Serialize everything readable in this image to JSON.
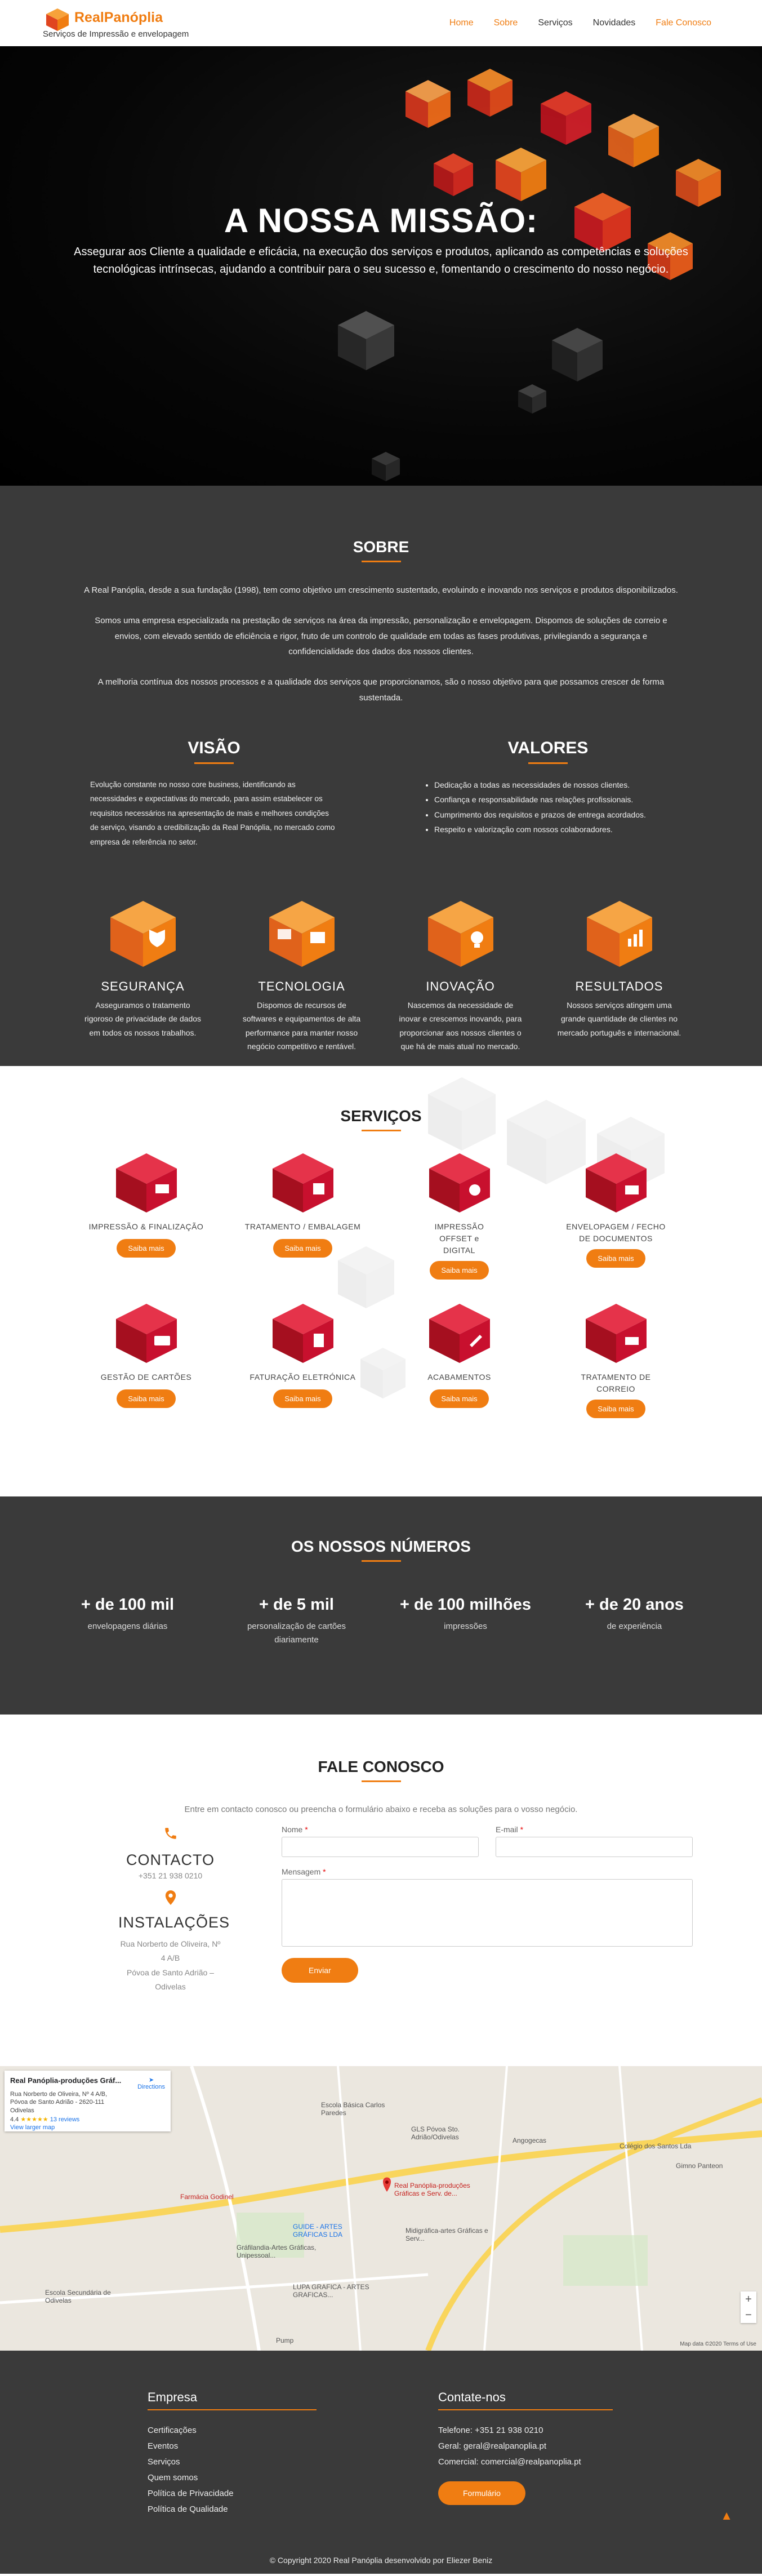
{
  "header": {
    "brand": "RealPanóplia",
    "tagline": "Serviços de Impressão e envelopagem",
    "nav": [
      "Home",
      "Sobre",
      "Serviços",
      "Novidades",
      "Fale Conosco"
    ]
  },
  "hero": {
    "title": "A NOSSA MISSÃO:",
    "text": "Assegurar aos Cliente a qualidade e eficácia, na execução dos serviços e produtos, aplicando as competências e soluções tecnológicas intrínsecas, ajudando a contribuir para o seu sucesso e, fomentando o crescimento do nosso negócio."
  },
  "sobre": {
    "title": "SOBRE",
    "p1": "A Real Panóplia, desde a sua fundação (1998), tem como objetivo um crescimento sustentado, evoluindo e inovando nos serviços e produtos disponibilizados.",
    "p2": "Somos uma empresa especializada na prestação de serviços na área da impressão, personalização e envelopagem. Dispomos de soluções de correio e envios, com elevado sentido de eficiência e rigor, fruto de um controlo de qualidade em todas as fases produtivas, privilegiando a segurança e confidencialidade dos dados dos nossos clientes.",
    "p3": "A melhoria contínua dos nossos processos e a qualidade dos serviços que proporcionamos, são o nosso objetivo para que possamos crescer de forma sustentada.",
    "visao_title": "VISÃO",
    "visao_text": "Evolução constante no nosso core business, identificando as necessidades e expectativas do mercado, para assim estabelecer os requisitos necessários na apresentação de mais e melhores condições de serviço, visando a credibilização da Real Panóplia, no mercado como empresa de referência no setor.",
    "valores_title": "VALORES",
    "valores": [
      "Dedicação a todas as necessidades de nossos clientes.",
      "Confiança e responsabilidade nas relações profissionais.",
      "Cumprimento dos requisitos e prazos de entrega acordados.",
      "Respeito e valorização com nossos colaboradores."
    ],
    "pillars": [
      {
        "title": "SEGURANÇA",
        "text": "Asseguramos o tratamento rigoroso de privacidade de dados em todos os nossos trabalhos."
      },
      {
        "title": "TECNOLOGIA",
        "text": "Dispomos de recursos de softwares e equipamentos de alta performance para manter nosso negócio competitivo e rentável."
      },
      {
        "title": "INOVAÇÃO",
        "text": "Nascemos da necessidade de inovar e crescemos inovando, para proporcionar aos nossos clientes o que há de mais atual no mercado."
      },
      {
        "title": "RESULTADOS",
        "text": "Nossos serviços atingem uma grande quantidade de clientes no mercado português e internacional."
      }
    ]
  },
  "servicos": {
    "title": "SERVIÇOS",
    "button": "Saiba mais",
    "items": [
      "IMPRESSÃO & FINALIZAÇÃO",
      "TRATAMENTO / EMBALAGEM",
      "IMPRESSÃO OFFSET e DIGITAL",
      "ENVELOPAGEM / FECHO DE DOCUMENTOS",
      "GESTÃO DE CARTÕES",
      "FATURAÇÃO ELETRÓNICA",
      "ACABAMENTOS",
      "TRATAMENTO DE CORREIO"
    ]
  },
  "numeros": {
    "title": "OS NOSSOS NÚMEROS",
    "items": [
      {
        "value": "+ de 100 mil",
        "desc": "envelopagens diárias"
      },
      {
        "value": "+ de 5 mil",
        "desc": "personalização de cartões diariamente"
      },
      {
        "value": "+ de 100 milhões",
        "desc": "impressões"
      },
      {
        "value": "+ de 20 anos",
        "desc": "de experiência"
      }
    ]
  },
  "fale": {
    "title": "FALE CONOSCO",
    "subtitle": "Entre em contacto conosco ou preencha o formulário abaixo e receba as soluções para o vosso negócio.",
    "contacto_title": "CONTACTO",
    "phone": "+351 21 938 0210",
    "instalacoes_title": "INSTALAÇÕES",
    "address1": "Rua Norberto de Oliveira, Nº 4 A/B",
    "address2": "Póvoa de Santo Adrião – Odivelas",
    "nome_label": "Nome",
    "email_label": "E-mail",
    "mensagem_label": "Mensagem",
    "required": "*",
    "send": "Enviar"
  },
  "map": {
    "place": "Real Panóplia-produções Gráf...",
    "addr": "Rua Norberto de Oliveira, Nº 4 A/B, Póvoa de Santo Adrião - 2620-111 Odivelas",
    "rating": "4.4",
    "reviews": "13 reviews",
    "larger": "View larger map",
    "directions": "Directions",
    "marker": "Real Panóplia-produções Gráficas e Serv. de...",
    "labels": [
      "Escola Básica Carlos Paredes",
      "GLS Póvoa Sto. Adrião/Odivelas",
      "Angogecas",
      "Colégio dos Santos Lda",
      "Gimno Panteon",
      "Farmácia Godinel",
      "GUIDE - ARTES GRÁFICAS LDA",
      "Midigráfica-artes Gráficas e Serv...",
      "Gráfilandia-Artes Gráficas, Unipessoal...",
      "LUPA GRAFICA - ARTES GRAFICAS...",
      "Escola Secundária de Odivelas",
      "Pump"
    ],
    "copyright": "Map data ©2020 Terms of Use"
  },
  "footer": {
    "col1_title": "Empresa",
    "col1_links": [
      "Certificações",
      "Eventos",
      "Serviços",
      "Quem somos",
      "Política de Privacidade",
      "Política de Qualidade"
    ],
    "col2_title": "Contate-nos",
    "tel": "Telefone: +351 21 938 0210",
    "geral": "Geral: geral@realpanoplia.pt",
    "comercial": "Comercial: comercial@realpanoplia.pt",
    "form_btn": "Formulário",
    "copyright": "© Copyright 2020 Real Panóplia desenvolvido por Eliezer Beniz"
  },
  "colors": {
    "accent": "#f07d12",
    "red": "#c8102e",
    "dark": "#3a3a3a"
  }
}
